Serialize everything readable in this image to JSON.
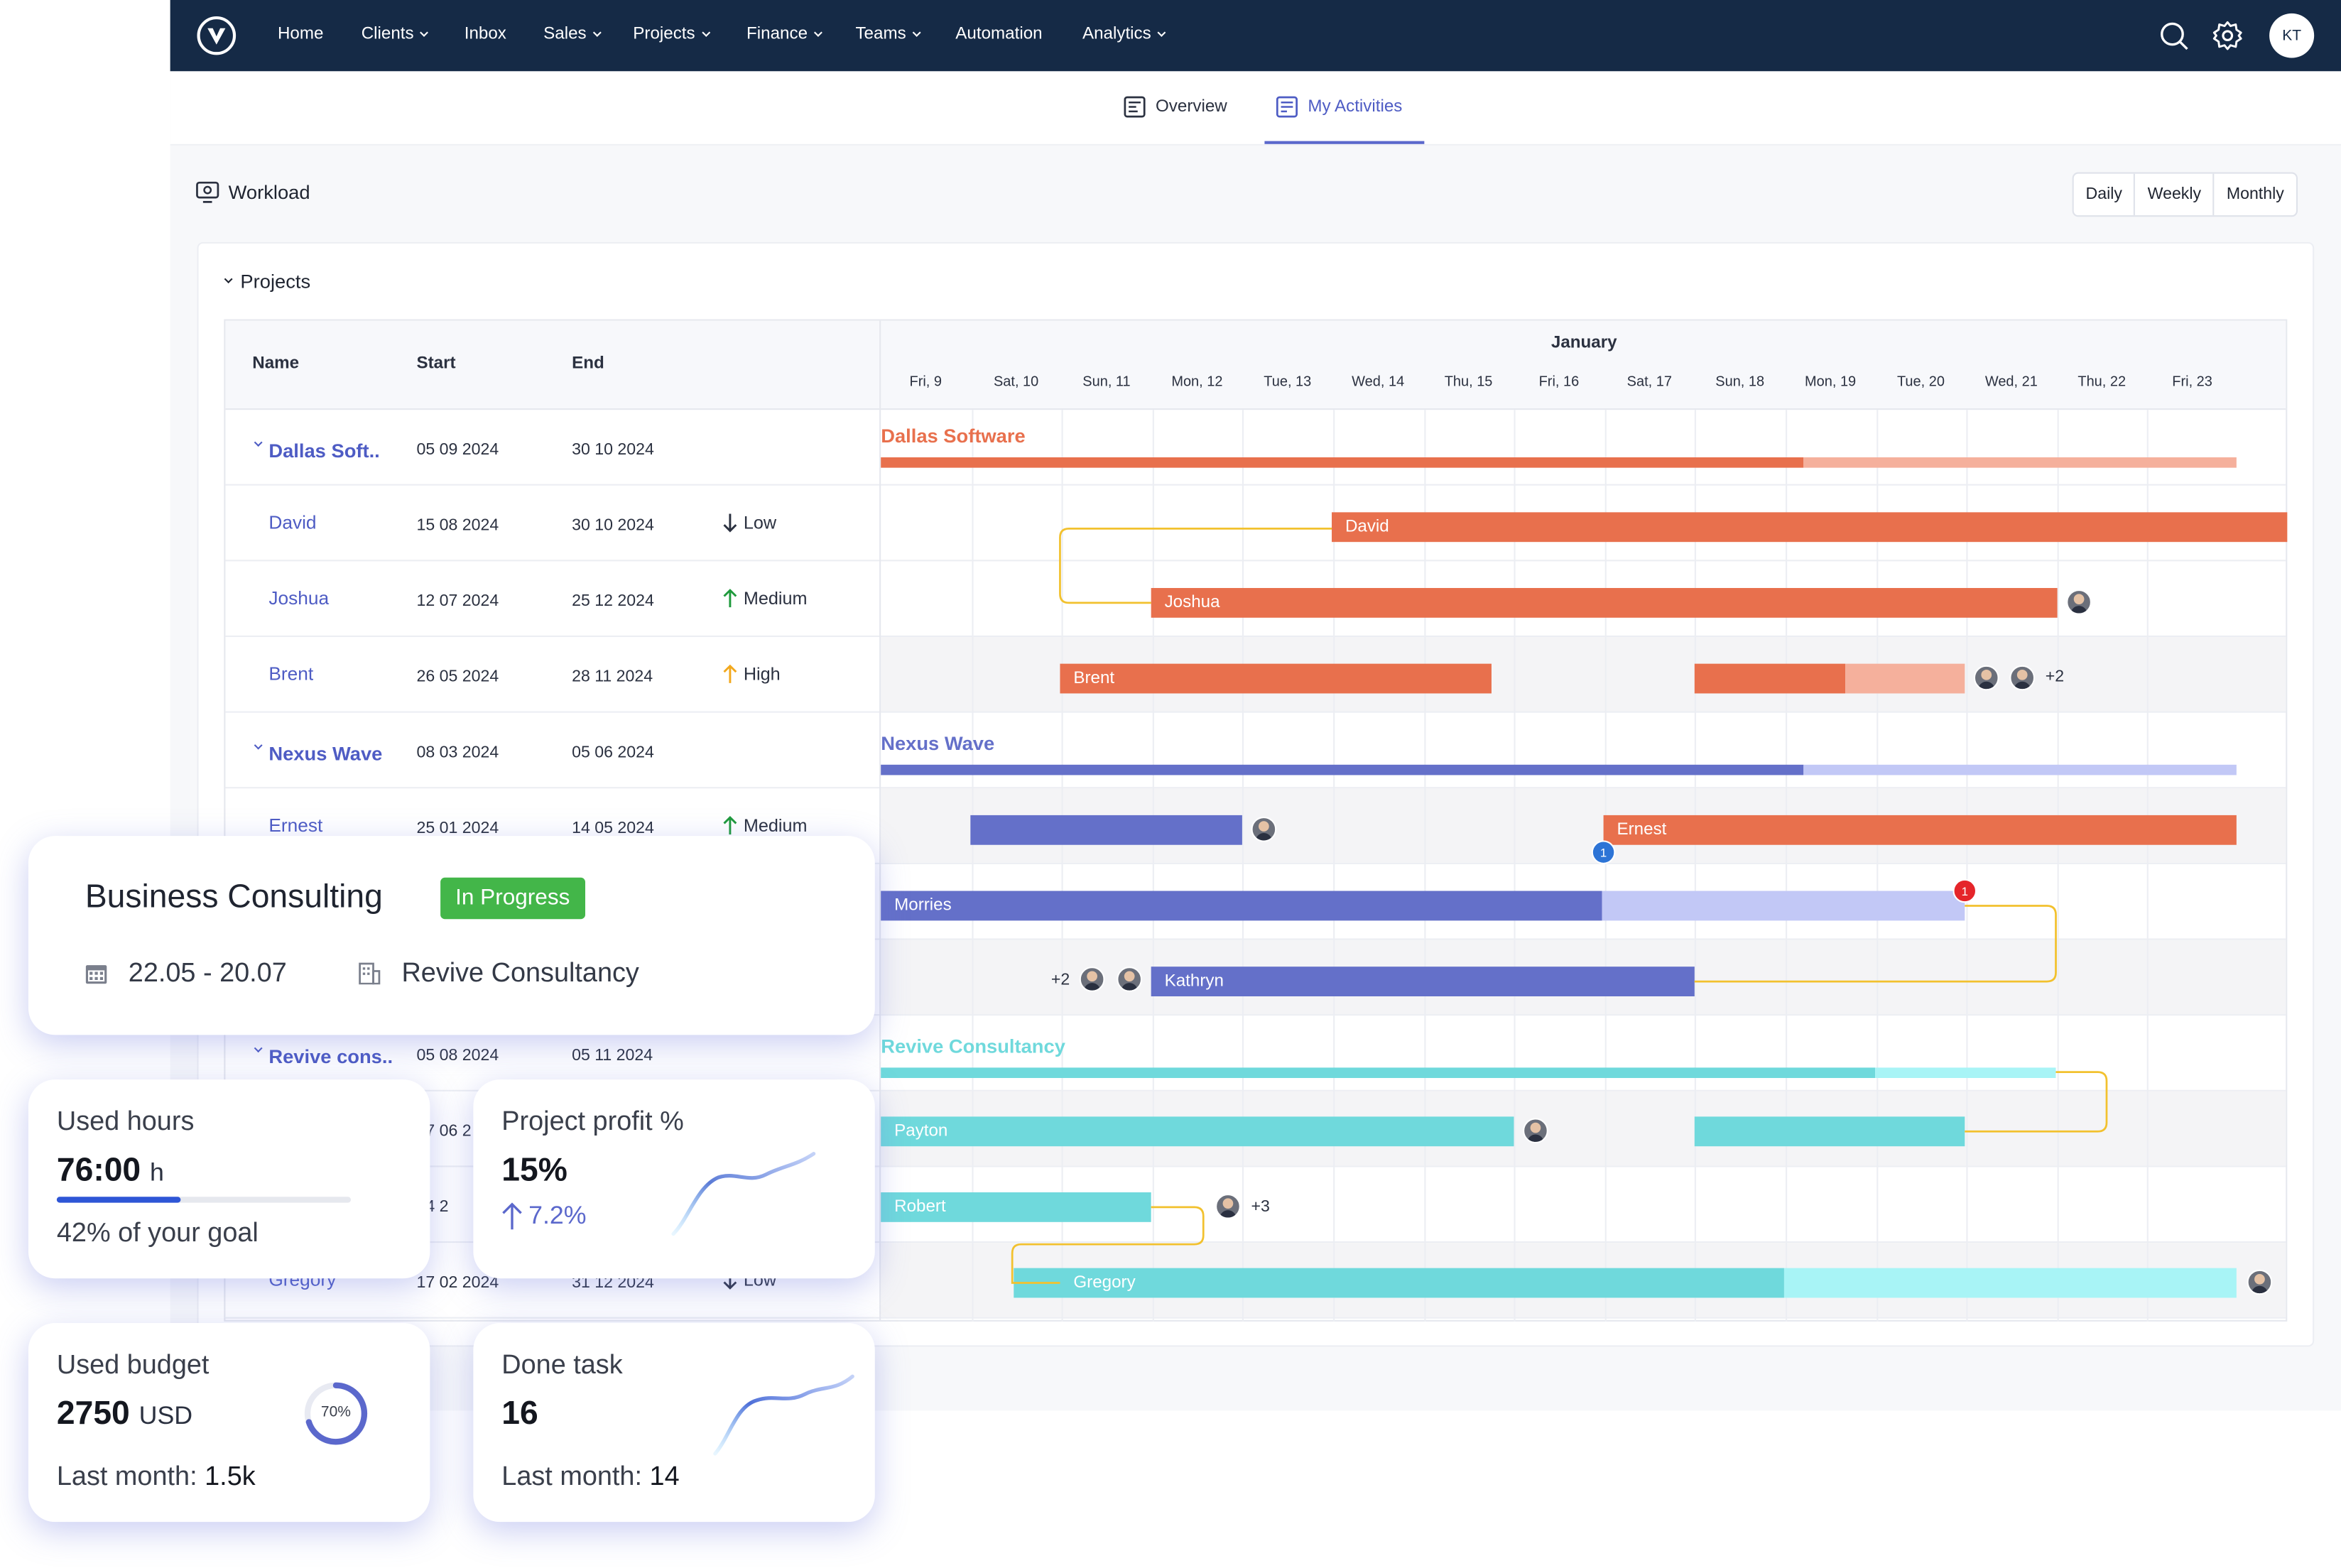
{
  "nav": {
    "items": [
      {
        "label": "Home",
        "has_menu": false
      },
      {
        "label": "Clients",
        "has_menu": true
      },
      {
        "label": "Inbox",
        "has_menu": false
      },
      {
        "label": "Sales",
        "has_menu": true
      },
      {
        "label": "Projects",
        "has_menu": true
      },
      {
        "label": "Finance",
        "has_menu": true
      },
      {
        "label": "Teams",
        "has_menu": true
      },
      {
        "label": "Automation",
        "has_menu": false
      },
      {
        "label": "Analytics",
        "has_menu": true
      }
    ],
    "icons": [
      "search-icon",
      "gear-icon"
    ],
    "user_initials": "KT",
    "colors": {
      "bg": "#152a46"
    }
  },
  "tabs": {
    "overview": "Overview",
    "my_activities": "My Activities",
    "active": "my_activities"
  },
  "workload": {
    "title": "Workload",
    "views": [
      "Daily",
      "Weekly",
      "Monthly"
    ],
    "section_title": "Projects"
  },
  "table": {
    "headers": {
      "name": "Name",
      "start": "Start",
      "end": "End"
    },
    "month": "January",
    "days": [
      "Fri, 9",
      "Sat, 10",
      "Sun, 11",
      "Mon, 12",
      "Tue, 13",
      "Wed, 14",
      "Thu, 15",
      "Fri, 16",
      "Sat, 17",
      "Sun, 18",
      "Mon, 19",
      "Tue, 20",
      "Wed, 21",
      "Thu, 22",
      "Fri, 23"
    ],
    "rows": [
      {
        "kind": "group",
        "name": "Dallas Soft..",
        "start": "05 09 2024",
        "end": "30 10 2024",
        "priority": ""
      },
      {
        "kind": "task",
        "name": "David",
        "start": "15 08 2024",
        "end": "30 10 2024",
        "priority": "Low"
      },
      {
        "kind": "task",
        "name": "Joshua",
        "start": "12 07 2024",
        "end": "25 12 2024",
        "priority": "Medium"
      },
      {
        "kind": "task",
        "name": "Brent",
        "start": "26 05 2024",
        "end": "28 11 2024",
        "priority": "High"
      },
      {
        "kind": "group",
        "name": "Nexus Wave",
        "start": "08 03 2024",
        "end": "05 06 2024",
        "priority": ""
      },
      {
        "kind": "task",
        "name": "Ernest",
        "start": "25 01 2024",
        "end": "14 05 2024",
        "priority": "Medium"
      },
      {
        "kind": "task",
        "name": "",
        "start": "",
        "end": "",
        "priority": ""
      },
      {
        "kind": "task",
        "name": "",
        "start": "",
        "end": "",
        "priority": ""
      },
      {
        "kind": "group",
        "name": "Revive cons..",
        "start": "05 08 2024",
        "end": "05 11 2024",
        "priority": ""
      },
      {
        "kind": "task",
        "name": "",
        "start": "07 06 2",
        "end": "",
        "priority": ""
      },
      {
        "kind": "task",
        "name": "",
        "start": "04 2",
        "end": "",
        "priority": ""
      },
      {
        "kind": "task",
        "name": "Gregory",
        "start": "17 02 2024",
        "end": "31 12 2024",
        "priority": "Low"
      }
    ],
    "priority_colors": {
      "Low": "#2b3140",
      "Medium": "#1f9a3c",
      "High": "#f2a81d"
    }
  },
  "gantt": {
    "groups": {
      "dallas": {
        "label": "Dallas Software",
        "color": "#e8704d",
        "light": "#f5b09c"
      },
      "nexus": {
        "label": "Nexus Wave",
        "color": "#6470c9",
        "light": "#c2c8f6"
      },
      "revive": {
        "label": "Revive Consultancy",
        "color": "#6fd9dc",
        "light": "#a8f4f6"
      }
    },
    "bar_labels": {
      "david": "David",
      "joshua": "Joshua",
      "brent": "Brent",
      "ernest": "Ernest",
      "morries": "Morries",
      "kathryn": "Kathryn",
      "payton": "Payton",
      "robert": "Robert",
      "gregory": "Gregory"
    },
    "extra_counts": {
      "brent": "+2",
      "kathryn": "+2",
      "robert": "+3"
    },
    "badges": {
      "ernest": "1",
      "morries": "1"
    },
    "link_color": "#f2c12e"
  },
  "cards": {
    "business": {
      "title": "Business Consulting",
      "status": "In Progress",
      "dates": "22.05 - 20.07",
      "client": "Revive Consultancy",
      "status_color": "#43b649"
    },
    "used_hours": {
      "label": "Used hours",
      "value": "76:00",
      "unit": "h",
      "progress": 0.42,
      "goal_text": "42% of your goal"
    },
    "profit": {
      "label": "Project profit %",
      "value": "15%",
      "delta": "7.2%"
    },
    "budget": {
      "label": "Used budget",
      "value": "2750",
      "unit": "USD",
      "last_label": "Last month:",
      "last_value": "1.5k",
      "ring_value": 0.7,
      "ring_text": "70%"
    },
    "done": {
      "label": "Done task",
      "value": "16",
      "last_label": "Last month:",
      "last_value": "14"
    }
  }
}
